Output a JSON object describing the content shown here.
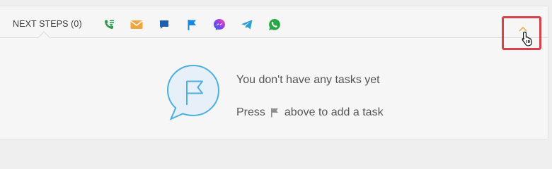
{
  "header": {
    "title": "NEXT STEPS (0)"
  },
  "actions": [
    {
      "name": "call-task-icon",
      "color": "#2e9b4c"
    },
    {
      "name": "email-icon",
      "color": "#f0a53d"
    },
    {
      "name": "chat-icon",
      "color": "#1e5fb3"
    },
    {
      "name": "flag-icon",
      "color": "#1887e0"
    },
    {
      "name": "messenger-icon",
      "color": "#7b3fe4"
    },
    {
      "name": "telegram-icon",
      "color": "#2a9fd6"
    },
    {
      "name": "whatsapp-icon",
      "color": "#27a844"
    }
  ],
  "collapse": {
    "icon": "chevron-up-icon",
    "accent": "#f0a53d",
    "highlight": "#d8414b"
  },
  "empty_state": {
    "title": "You don't have any tasks yet",
    "hint_before": "Press",
    "hint_icon": "flag-icon",
    "hint_after": "above to add a task"
  }
}
